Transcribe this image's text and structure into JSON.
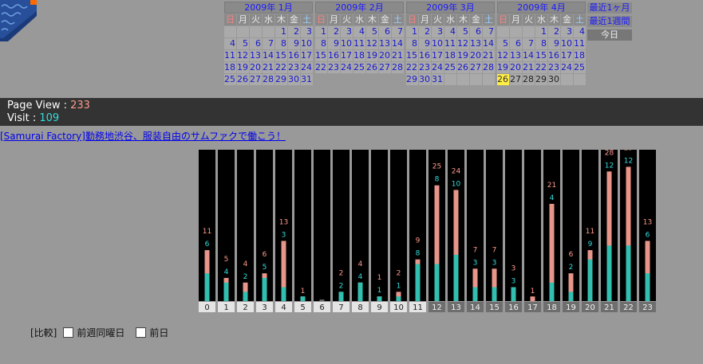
{
  "weekday_headers": [
    "日",
    "月",
    "火",
    "水",
    "木",
    "金",
    "土"
  ],
  "calendars": [
    {
      "title": "2009年 1月",
      "weeks": [
        [
          "",
          "",
          "",
          "",
          "1",
          "2",
          "3"
        ],
        [
          "4",
          "5",
          "6",
          "7",
          "8",
          "9",
          "10"
        ],
        [
          "11",
          "12",
          "13",
          "14",
          "15",
          "16",
          "17"
        ],
        [
          "18",
          "19",
          "20",
          "21",
          "22",
          "23",
          "24"
        ],
        [
          "25",
          "26",
          "27",
          "28",
          "29",
          "30",
          "31"
        ]
      ]
    },
    {
      "title": "2009年 2月",
      "weeks": [
        [
          "1",
          "2",
          "3",
          "4",
          "5",
          "6",
          "7"
        ],
        [
          "8",
          "9",
          "10",
          "11",
          "12",
          "13",
          "14"
        ],
        [
          "15",
          "16",
          "17",
          "18",
          "19",
          "20",
          "21"
        ],
        [
          "22",
          "23",
          "24",
          "25",
          "26",
          "27",
          "28"
        ]
      ]
    },
    {
      "title": "2009年 3月",
      "weeks": [
        [
          "1",
          "2",
          "3",
          "4",
          "5",
          "6",
          "7"
        ],
        [
          "8",
          "9",
          "10",
          "11",
          "12",
          "13",
          "14"
        ],
        [
          "15",
          "16",
          "17",
          "18",
          "19",
          "20",
          "21"
        ],
        [
          "22",
          "23",
          "24",
          "25",
          "26",
          "27",
          "28"
        ],
        [
          "29",
          "30",
          "31",
          "",
          "",
          "",
          ""
        ]
      ]
    },
    {
      "title": "2009年 4月",
      "weeks": [
        [
          "",
          "",
          "",
          "1",
          "2",
          "3",
          "4"
        ],
        [
          "5",
          "6",
          "7",
          "8",
          "9",
          "10",
          "11"
        ],
        [
          "12",
          "13",
          "14",
          "15",
          "16",
          "17",
          "18"
        ],
        [
          "19",
          "20",
          "21",
          "22",
          "23",
          "24",
          "25"
        ],
        [
          "26",
          "27",
          "28",
          "29",
          "30",
          "",
          ""
        ]
      ],
      "today": "26",
      "future": [
        "27",
        "28",
        "29",
        "30"
      ]
    }
  ],
  "quick_links": {
    "last_month": "最近1ヶ月",
    "last_week": "最近1週間",
    "today": "今日"
  },
  "stats": {
    "page_view_label": "Page View : ",
    "page_view_value": "233",
    "visit_label": "Visit : ",
    "visit_value": "109"
  },
  "ad_link": "[Samurai Factory]勤務地渋谷、服装自由のサムファクで働こう！",
  "compare": {
    "label": "[比較]",
    "option1": "前週同曜日",
    "option2": "前日"
  },
  "colors": {
    "pageview": "#e8958a",
    "visit": "#33bfb0",
    "pv_text": "#ff9a8a",
    "visit_text": "#33dddd"
  },
  "chart_data": {
    "type": "bar",
    "categories": [
      "0",
      "1",
      "2",
      "3",
      "4",
      "5",
      "6",
      "7",
      "8",
      "9",
      "10",
      "11",
      "12",
      "13",
      "14",
      "15",
      "16",
      "17",
      "18",
      "19",
      "20",
      "21",
      "22",
      "23"
    ],
    "series": [
      {
        "name": "Page View",
        "values": [
          11,
          5,
          4,
          6,
          13,
          1,
          0,
          2,
          4,
          1,
          2,
          9,
          25,
          24,
          7,
          7,
          3,
          1,
          21,
          6,
          11,
          28,
          29,
          13
        ]
      },
      {
        "name": "Visit",
        "values": [
          6,
          4,
          2,
          5,
          3,
          1,
          0,
          2,
          4,
          1,
          1,
          8,
          8,
          10,
          3,
          3,
          3,
          0,
          4,
          2,
          9,
          12,
          12,
          6
        ]
      }
    ],
    "value_labels": {
      "page_view": [
        "11",
        "5",
        "4",
        "6",
        "13",
        "1",
        "",
        "2",
        "4",
        "1",
        "2",
        "9",
        "25",
        "24",
        "7",
        "7",
        "3",
        "1",
        "21",
        "6",
        "11",
        "28",
        "29",
        "13"
      ],
      "visit": [
        "6",
        "4",
        "2",
        "5",
        "3",
        "",
        "",
        "2",
        "4",
        "1",
        "1",
        "8",
        "8",
        "10",
        "3",
        "3",
        "3",
        "",
        "4",
        "2",
        "9",
        "12",
        "12",
        "6"
      ]
    },
    "ylim": [
      0,
      32
    ]
  }
}
